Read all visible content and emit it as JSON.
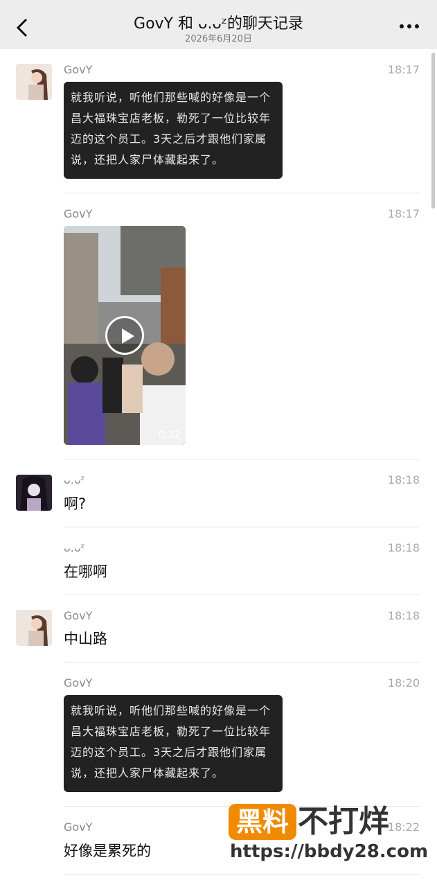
{
  "header": {
    "title": "GovY 和 ᴗ.ᴗᶻ的聊天记录",
    "date": "2026年6月20日",
    "back_icon": "chevron-left-icon",
    "more_icon": "more-dots-icon"
  },
  "messages": [
    {
      "sender": "GovY",
      "time": "18:17",
      "type": "image-text",
      "text": "就我听说，听他们那些喊的好像是一个昌大福珠宝店老板，勒死了一位比较年迈的这个员工。3天之后才跟他们家属说，还把人家尸体藏起来了。"
    },
    {
      "sender": "GovY",
      "time": "18:17",
      "type": "video",
      "duration": "0:32"
    },
    {
      "sender": "ᴗ.ᴗᶻ",
      "time": "18:18",
      "type": "text",
      "text": "啊?"
    },
    {
      "sender": "ᴗ.ᴗᶻ",
      "time": "18:18",
      "type": "text",
      "text": "在哪啊"
    },
    {
      "sender": "GovY",
      "time": "18:18",
      "type": "text",
      "text": "中山路"
    },
    {
      "sender": "GovY",
      "time": "18:20",
      "type": "image-text",
      "text": "就我听说，听他们那些喊的好像是一个昌大福珠宝店老板，勒死了一位比较年迈的这个员工。3天之后才跟他们家属说，还把人家尸体藏起来了。"
    },
    {
      "sender": "GovY",
      "time": "18:22",
      "type": "text",
      "text": "好像是累死的"
    }
  ],
  "watermark": {
    "badge": "黑料",
    "slogan": "不打烊",
    "url": "https://bbdy28.com"
  },
  "colors": {
    "header_bg": "#ededed",
    "watermark_orange": "#f08a00",
    "name_gray": "#888888"
  }
}
